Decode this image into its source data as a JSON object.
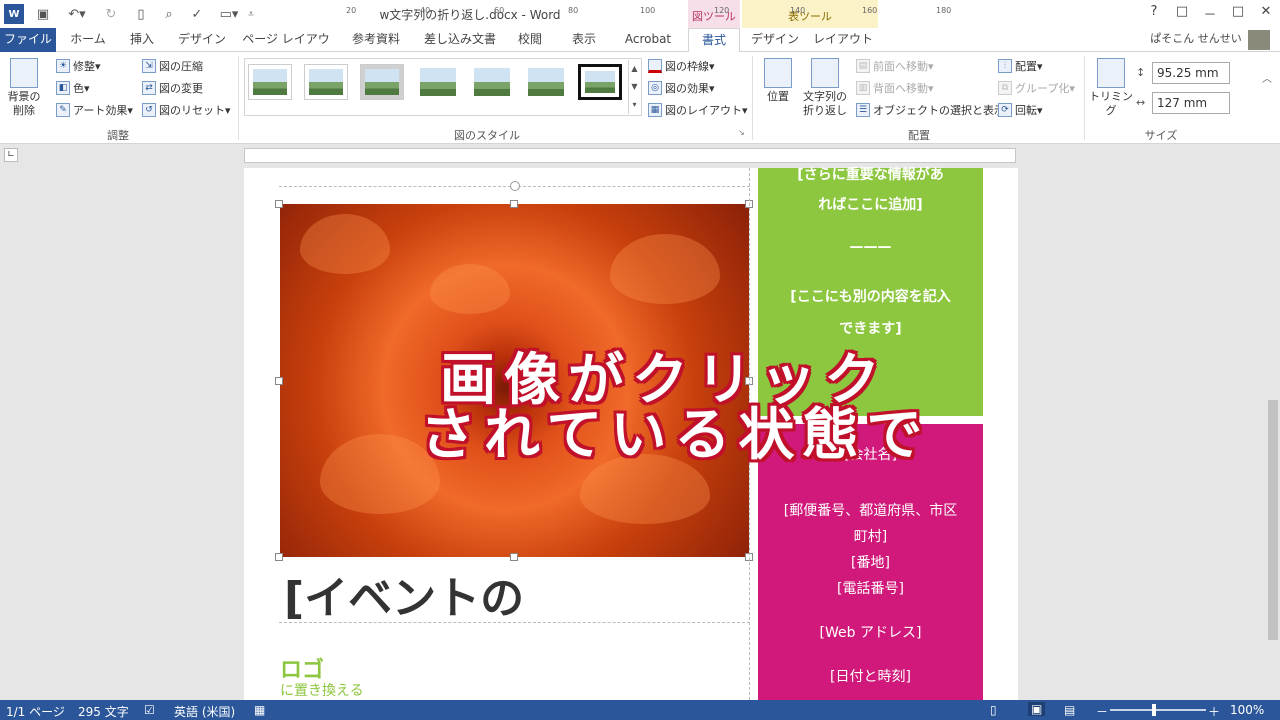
{
  "window": {
    "title": "w文字列の折り返し.docx - Word"
  },
  "context_labels": {
    "picture_tools": "図ツール",
    "table_tools": "表ツール"
  },
  "window_controls": {
    "help": "?",
    "ribbon_opts": "□",
    "minimize": "－",
    "maximize": "□",
    "close": "✕"
  },
  "tabs": {
    "file": "ファイル",
    "home": "ホーム",
    "insert": "挿入",
    "design": "デザイン",
    "page_layout": "ページ レイアウト",
    "references": "参考資料",
    "mailings": "差し込み文書",
    "review": "校閲",
    "view": "表示",
    "acrobat": "Acrobat",
    "format": "書式",
    "table_design": "デザイン",
    "table_layout": "レイアウト"
  },
  "user": {
    "name": "ぱそこん せんせい"
  },
  "ribbon": {
    "adjust": {
      "remove_bg": "背景の\n削除",
      "corrections": "修整",
      "color": "色",
      "artistic": "アート効果",
      "compress": "図の圧縮",
      "change": "図の変更",
      "reset": "図のリセット",
      "label": "調整"
    },
    "styles": {
      "border": "図の枠線",
      "effects": "図の効果",
      "layout": "図のレイアウト",
      "label": "図のスタイル"
    },
    "arrange": {
      "position": "位置",
      "wrap_text": "文字列の\n折り返し",
      "bring_forward": "前面へ移動",
      "send_backward": "背面へ移動",
      "selection_pane": "オブジェクトの選択と表示",
      "align": "配置",
      "group": "グループ化",
      "rotate": "回転",
      "label": "配置"
    },
    "size": {
      "crop": "トリミング",
      "height": "95.25 mm",
      "width": "127 mm",
      "label": "サイズ"
    }
  },
  "ruler": {
    "ticks": [
      "20",
      "40",
      "60",
      "80",
      "100",
      "120",
      "140",
      "160",
      "180"
    ]
  },
  "document": {
    "green_box": {
      "line1": "[さらに重要な情報があ",
      "line2": "ればここに追加]",
      "divider": "———",
      "line3": "[ここにも別の内容を記入",
      "line4": "できます]"
    },
    "pink_box": {
      "company": "[会社名]",
      "address1": "[郵便番号、都道府県、市区",
      "address2": "町村]",
      "street": "[番地]",
      "phone": "[電話番号]",
      "web": "[Web アドレス]",
      "datetime": "[日付と時刻]"
    },
    "event_title": "[イベントの",
    "logo_title": "ロゴ",
    "logo_sub": "に置き換える"
  },
  "overlay": {
    "line1": "画像がクリック",
    "line2": "されている状態で"
  },
  "status": {
    "page": "1/1 ページ",
    "words": "295 文字",
    "language": "英語 (米国)",
    "zoom": "100%"
  }
}
